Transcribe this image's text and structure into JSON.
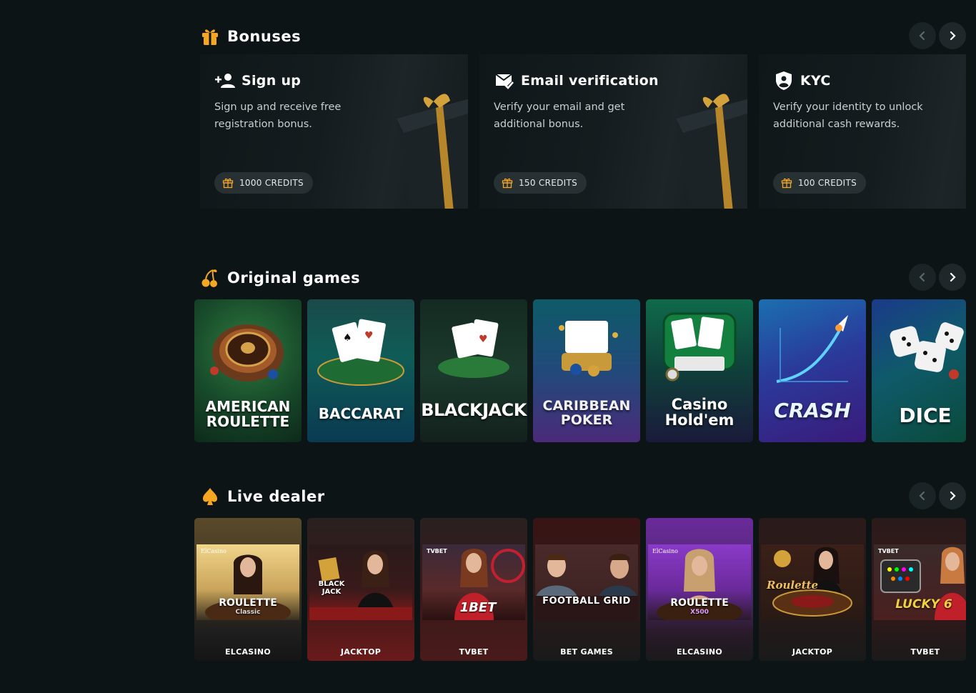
{
  "colors": {
    "background": "#0c1416",
    "accent": "#f5a623",
    "card": "#151d20",
    "badge": "#273033"
  },
  "bonuses": {
    "title": "Bonuses",
    "icon": "gift-icon",
    "cards": [
      {
        "title": "Sign up",
        "icon": "add-user-icon",
        "description": "Sign up and receive free registration bonus.",
        "credits": "1000 CREDITS"
      },
      {
        "title": "Email verification",
        "icon": "email-check-icon",
        "description": "Verify your email and get additional bonus.",
        "credits": "150 CREDITS"
      },
      {
        "title": "KYC",
        "icon": "shield-user-icon",
        "description": "Verify your identity to unlock additional cash rewards.",
        "credits": "100 CREDITS"
      }
    ]
  },
  "original_games": {
    "title": "Original games",
    "icon": "cherry-icon",
    "games": [
      {
        "name_line1": "AMERICAN",
        "name_line2": "ROULETTE"
      },
      {
        "name_line1": "BACCARAT",
        "name_line2": ""
      },
      {
        "name_line1": "BLACKJACK",
        "name_line2": ""
      },
      {
        "name_line1": "CARIBBEAN",
        "name_line2": "POKER"
      },
      {
        "name_line1": "Casino",
        "name_line2": "Hold'em"
      },
      {
        "name_line1": "CRASH",
        "name_line2": ""
      },
      {
        "name_line1": "DICE",
        "name_line2": ""
      }
    ]
  },
  "live_dealer": {
    "title": "Live dealer",
    "icon": "spade-icon",
    "games": [
      {
        "provider": "ELCASINO",
        "label": "ROULETTE",
        "sublabel": "Classic",
        "brand": "ElCasino"
      },
      {
        "provider": "JACKTOP",
        "label": "BLACK JACK",
        "sublabel": "",
        "brand": ""
      },
      {
        "provider": "TVBET",
        "label": "1BET",
        "sublabel": "",
        "brand": "TVBET"
      },
      {
        "provider": "BET GAMES",
        "label": "FOOTBALL GRID",
        "sublabel": "",
        "brand": ""
      },
      {
        "provider": "ELCASINO",
        "label": "ROULETTE",
        "sublabel": "X500",
        "brand": "ElCasino"
      },
      {
        "provider": "JACKTOP",
        "label": "Roulette",
        "sublabel": "",
        "brand": ""
      },
      {
        "provider": "TVBET",
        "label": "LUCKY 6",
        "sublabel": "",
        "brand": "TVBET"
      }
    ]
  }
}
